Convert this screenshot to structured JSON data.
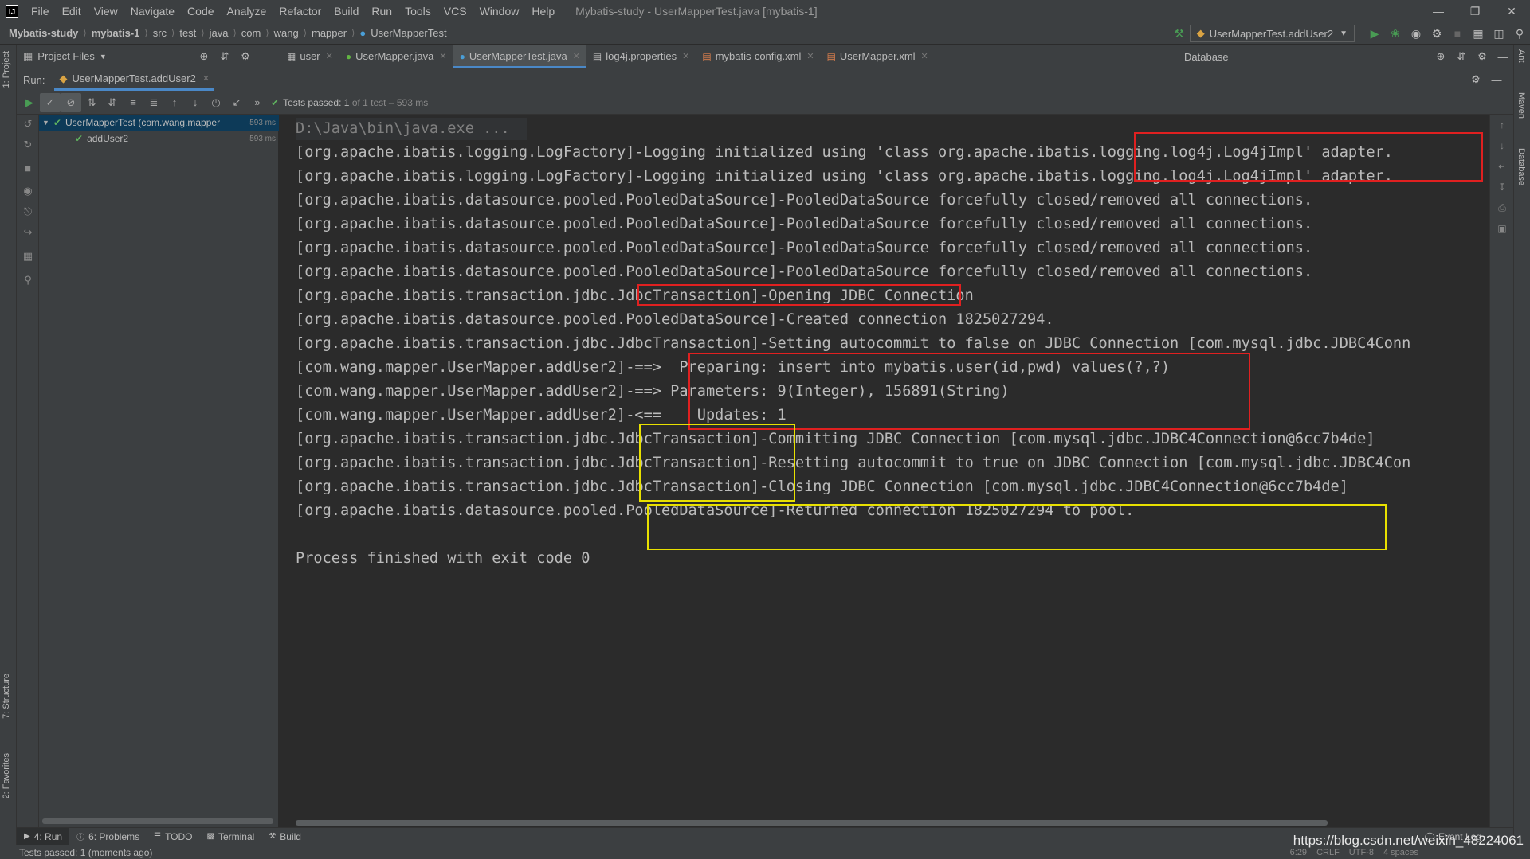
{
  "menubar": {
    "logo": "IJ",
    "items": [
      "File",
      "Edit",
      "View",
      "Navigate",
      "Code",
      "Analyze",
      "Refactor",
      "Build",
      "Run",
      "Tools",
      "VCS",
      "Window",
      "Help"
    ],
    "window_title": "Mybatis-study - UserMapperTest.java [mybatis-1]"
  },
  "breadcrumb": [
    "Mybatis-study",
    "mybatis-1",
    "src",
    "test",
    "java",
    "com",
    "wang",
    "mapper",
    "UserMapperTest"
  ],
  "run_config": "UserMapperTest.addUser2",
  "project_panel": {
    "label": "Project Files"
  },
  "tabs": [
    {
      "label": "user"
    },
    {
      "label": "UserMapper.java"
    },
    {
      "label": "UserMapperTest.java"
    },
    {
      "label": "log4j.properties"
    },
    {
      "label": "mybatis-config.xml"
    },
    {
      "label": "UserMapper.xml"
    }
  ],
  "database_panel": {
    "label": "Database"
  },
  "run_panel": {
    "run_label": "Run:",
    "run_tab": "UserMapperTest.addUser2",
    "tests_passed_prefix": "Tests passed:",
    "tests_passed_count": "1",
    "tests_passed_suffix": "of 1 test – 593 ms"
  },
  "test_tree": [
    {
      "label": "UserMapperTest (com.wang.mapper",
      "duration": "593 ms"
    },
    {
      "label": "addUser2",
      "duration": "593 ms"
    }
  ],
  "console": {
    "lines": [
      "D:\\Java\\bin\\java.exe ...",
      "[org.apache.ibatis.logging.LogFactory]-Logging initialized using 'class org.apache.ibatis.logging.log4j.Log4jImpl' adapter.",
      "[org.apache.ibatis.logging.LogFactory]-Logging initialized using 'class org.apache.ibatis.logging.log4j.Log4jImpl' adapter.",
      "[org.apache.ibatis.datasource.pooled.PooledDataSource]-PooledDataSource forcefully closed/removed all connections.",
      "[org.apache.ibatis.datasource.pooled.PooledDataSource]-PooledDataSource forcefully closed/removed all connections.",
      "[org.apache.ibatis.datasource.pooled.PooledDataSource]-PooledDataSource forcefully closed/removed all connections.",
      "[org.apache.ibatis.datasource.pooled.PooledDataSource]-PooledDataSource forcefully closed/removed all connections.",
      "[org.apache.ibatis.transaction.jdbc.JdbcTransaction]-Opening JDBC Connection",
      "[org.apache.ibatis.datasource.pooled.PooledDataSource]-Created connection 1825027294.",
      "[org.apache.ibatis.transaction.jdbc.JdbcTransaction]-Setting autocommit to false on JDBC Connection [com.mysql.jdbc.JDBC4Conn",
      "[com.wang.mapper.UserMapper.addUser2]-==>  Preparing: insert into mybatis.user(id,pwd) values(?,?)",
      "[com.wang.mapper.UserMapper.addUser2]-==> Parameters: 9(Integer), 156891(String)",
      "[com.wang.mapper.UserMapper.addUser2]-<==    Updates: 1",
      "[org.apache.ibatis.transaction.jdbc.JdbcTransaction]-Committing JDBC Connection [com.mysql.jdbc.JDBC4Connection@6cc7b4de]",
      "[org.apache.ibatis.transaction.jdbc.JdbcTransaction]-Resetting autocommit to true on JDBC Connection [com.mysql.jdbc.JDBC4Con",
      "[org.apache.ibatis.transaction.jdbc.JdbcTransaction]-Closing JDBC Connection [com.mysql.jdbc.JDBC4Connection@6cc7b4de]",
      "[org.apache.ibatis.datasource.pooled.PooledDataSource]-Returned connection 1825027294 to pool.",
      "",
      "Process finished with exit code 0"
    ]
  },
  "side_labels": {
    "left_top": "1: Project",
    "left_structure": "7: Structure",
    "left_favorites": "2: Favorites",
    "right_ant": "Ant",
    "right_maven": "Maven",
    "right_database": "Database"
  },
  "bottom_tabs": [
    {
      "label": "4: Run"
    },
    {
      "label": "6: Problems"
    },
    {
      "label": "TODO"
    },
    {
      "label": "Terminal"
    },
    {
      "label": "Build"
    }
  ],
  "event_log": "Event Log",
  "status": {
    "text": "Tests passed: 1 (moments ago)",
    "position": "6:29",
    "line_sep": "CRLF",
    "encoding": "UTF-8",
    "indent": "4 spaces"
  },
  "watermark": "https://blog.csdn.net/weixin_48224061",
  "colors": {
    "highlight_red": "#e02020",
    "highlight_yellow": "#e8e000",
    "pass_green": "#5fb35f",
    "accent_blue": "#4a88c7"
  }
}
